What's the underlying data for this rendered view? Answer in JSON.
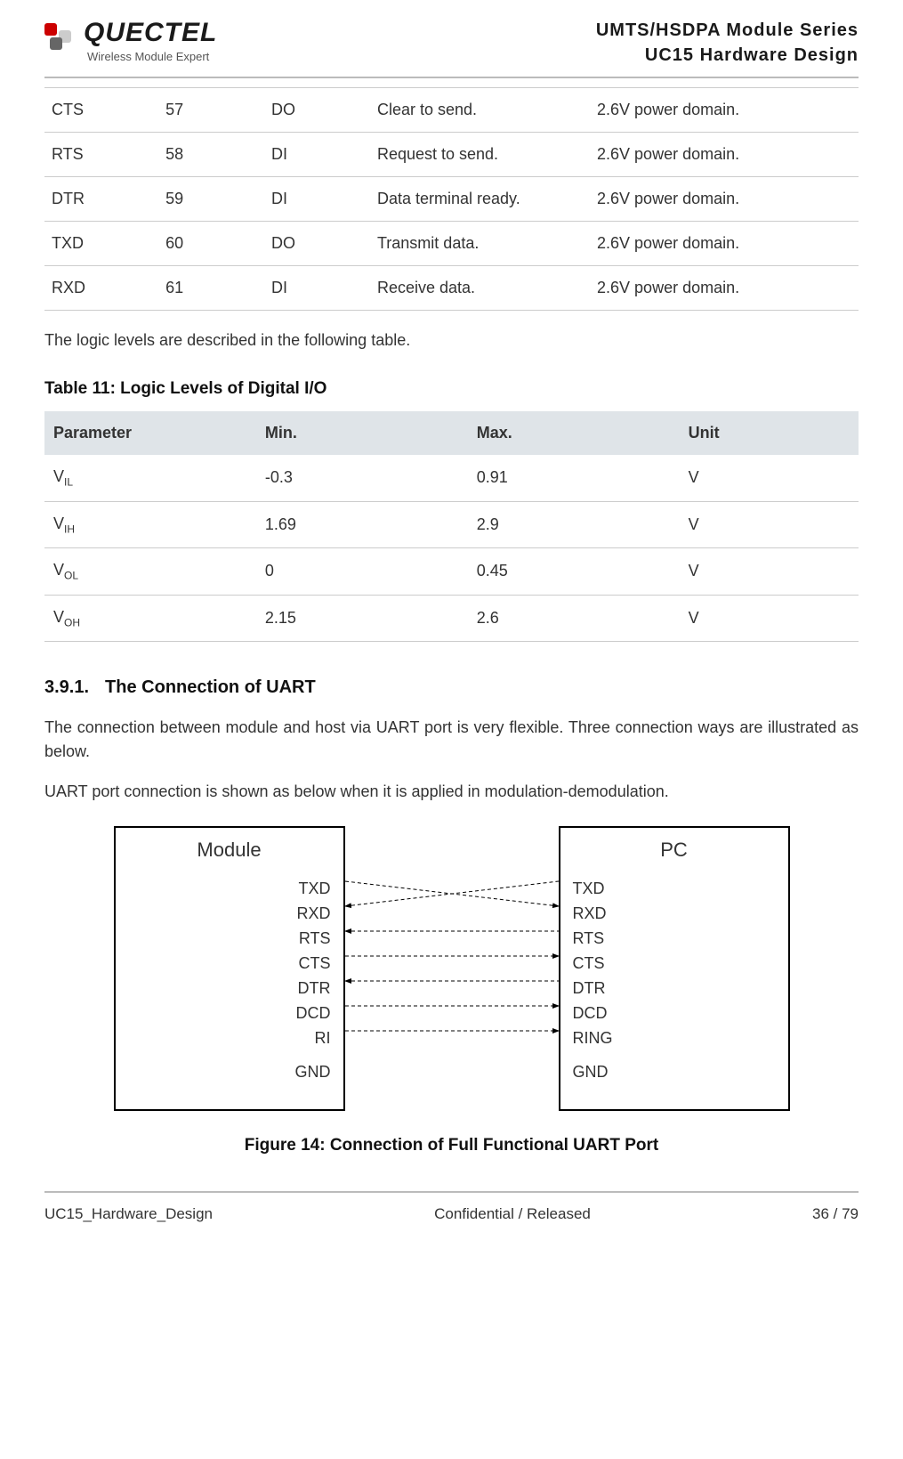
{
  "header": {
    "logo_brand": "QUECTEL",
    "logo_tag": "Wireless Module Expert",
    "series": "UMTS/HSDPA  Module  Series",
    "design": "UC15  Hardware  Design"
  },
  "pin_table": {
    "rows": [
      {
        "name": "CTS",
        "pin": "57",
        "io": "DO",
        "desc": "Clear to send.",
        "dom": "2.6V power domain."
      },
      {
        "name": "RTS",
        "pin": "58",
        "io": "DI",
        "desc": "Request to send.",
        "dom": "2.6V power domain."
      },
      {
        "name": "DTR",
        "pin": "59",
        "io": "DI",
        "desc": "Data terminal ready.",
        "dom": "2.6V power domain."
      },
      {
        "name": "TXD",
        "pin": "60",
        "io": "DO",
        "desc": "Transmit data.",
        "dom": "2.6V power domain."
      },
      {
        "name": "RXD",
        "pin": "61",
        "io": "DI",
        "desc": "Receive data.",
        "dom": "2.6V power domain."
      }
    ]
  },
  "text": {
    "logic_intro": "The logic levels are described in the following table.",
    "table11_title": "Table 11: Logic Levels of Digital I/O",
    "section_num": "3.9.1.",
    "section_title": "The Connection of UART",
    "para1": "The connection between module and host via UART port is very flexible. Three connection ways are illustrated as below.",
    "para2": "UART port connection is shown as below when it is applied in modulation-demodulation.",
    "fig_caption": "Figure 14: Connection of Full Functional UART Port"
  },
  "logic_table": {
    "headers": [
      "Parameter",
      "Min.",
      "Max.",
      "Unit"
    ],
    "rows": [
      {
        "param": "V",
        "sub": "IL",
        "min": "-0.3",
        "max": "0.91",
        "unit": "V"
      },
      {
        "param": "V",
        "sub": "IH",
        "min": "1.69",
        "max": "2.9",
        "unit": "V"
      },
      {
        "param": "V",
        "sub": "OL",
        "min": "0",
        "max": "0.45",
        "unit": "V"
      },
      {
        "param": "V",
        "sub": "OH",
        "min": "2.15",
        "max": "2.6",
        "unit": "V"
      }
    ]
  },
  "diagram": {
    "left_title": "Module",
    "right_title": "PC",
    "left_pins": [
      "TXD",
      "RXD",
      "RTS",
      "CTS",
      "DTR",
      "DCD",
      "RI",
      "GND"
    ],
    "right_pins": [
      "TXD",
      "RXD",
      "RTS",
      "CTS",
      "DTR",
      "DCD",
      "RING",
      "GND"
    ]
  },
  "footer": {
    "left": "UC15_Hardware_Design",
    "mid": "Confidential / Released",
    "right": "36 / 79"
  }
}
